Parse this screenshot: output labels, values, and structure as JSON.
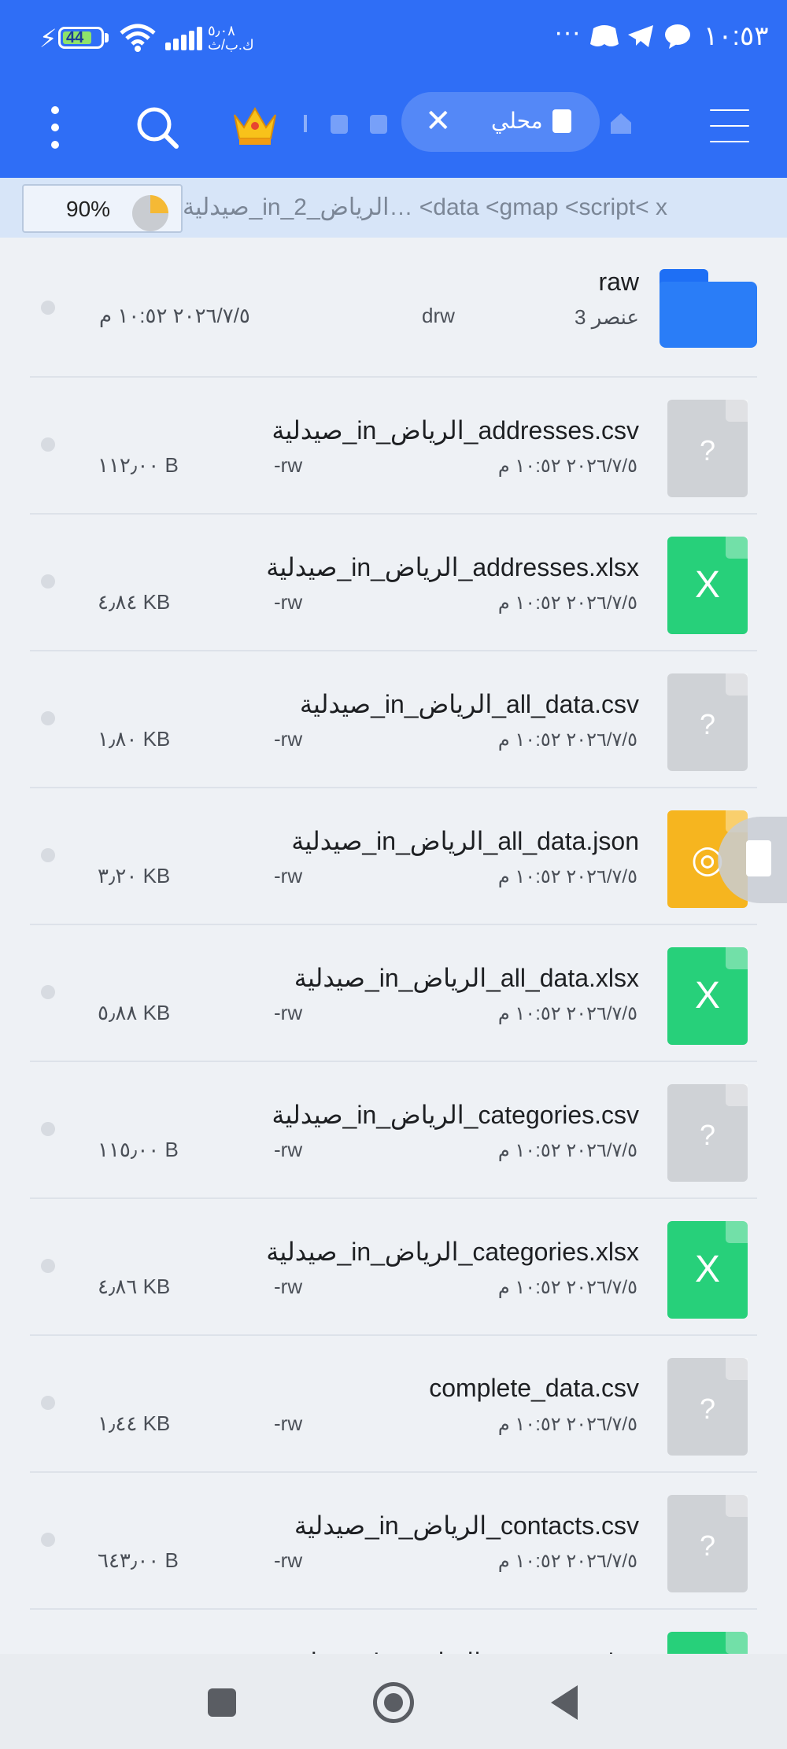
{
  "status_bar": {
    "time": "١٠:٥٣",
    "battery": "44",
    "network_speed": "٥٫٠٨\nك.ب/ث",
    "more": "···"
  },
  "app_bar": {
    "location_chip": "محلي"
  },
  "path_bar": {
    "storage_percent": "90%",
    "breadcrumb": "صيدلية_in_الرياض_2… <data <gmap <script< x"
  },
  "files": [
    {
      "name": "raw",
      "type": "folder",
      "info": "3 عنصر",
      "perm": "drw",
      "date": "٢٠٢٦/٧/٥ ١٠:٥٢ م",
      "size": ""
    },
    {
      "name": "صيدلية_in_الرياض_addresses.csv",
      "type": "unknown",
      "date": "٢٠٢٦/٧/٥ ١٠:٥٢ م",
      "perm": "-rw",
      "size": "١١٢٫٠٠ B"
    },
    {
      "name": "صيدلية_in_الرياض_addresses.xlsx",
      "type": "excel",
      "date": "٢٠٢٦/٧/٥ ١٠:٥٢ م",
      "perm": "-rw",
      "size": "٤٫٨٤ KB"
    },
    {
      "name": "صيدلية_in_الرياض_all_data.csv",
      "type": "unknown",
      "date": "٢٠٢٦/٧/٥ ١٠:٥٢ م",
      "perm": "-rw",
      "size": "١٫٨٠ KB"
    },
    {
      "name": "صيدلية_in_الرياض_all_data.json",
      "type": "json",
      "date": "٢٠٢٦/٧/٥ ١٠:٥٢ م",
      "perm": "-rw",
      "size": "٣٫٢٠ KB"
    },
    {
      "name": "صيدلية_in_الرياض_all_data.xlsx",
      "type": "excel",
      "date": "٢٠٢٦/٧/٥ ١٠:٥٢ م",
      "perm": "-rw",
      "size": "٥٫٨٨ KB"
    },
    {
      "name": "صيدلية_in_الرياض_categories.csv",
      "type": "unknown",
      "date": "٢٠٢٦/٧/٥ ١٠:٥٢ م",
      "perm": "-rw",
      "size": "١١٥٫٠٠ B"
    },
    {
      "name": "صيدلية_in_الرياض_categories.xlsx",
      "type": "excel",
      "date": "٢٠٢٦/٧/٥ ١٠:٥٢ م",
      "perm": "-rw",
      "size": "٤٫٨٦ KB"
    },
    {
      "name": "complete_data.csv",
      "type": "unknown",
      "date": "٢٠٢٦/٧/٥ ١٠:٥٢ م",
      "perm": "-rw",
      "size": "١٫٤٤ KB"
    },
    {
      "name": "صيدلية_in_الرياض_contacts.csv",
      "type": "unknown",
      "date": "٢٠٢٦/٧/٥ ١٠:٥٢ م",
      "perm": "-rw",
      "size": "٦٤٣٫٠٠ B"
    },
    {
      "name": "صيدلية_in_الرياض_contacts.xlsx",
      "type": "excel",
      "date": "",
      "perm": "",
      "size": ""
    }
  ],
  "icon_glyphs": {
    "unknown": "?",
    "excel": "X",
    "json": "◎"
  },
  "colors": {
    "primary": "#2f6ef6",
    "excel": "#27d07a",
    "json": "#f6b51f",
    "unknown": "#cfd2d6"
  }
}
